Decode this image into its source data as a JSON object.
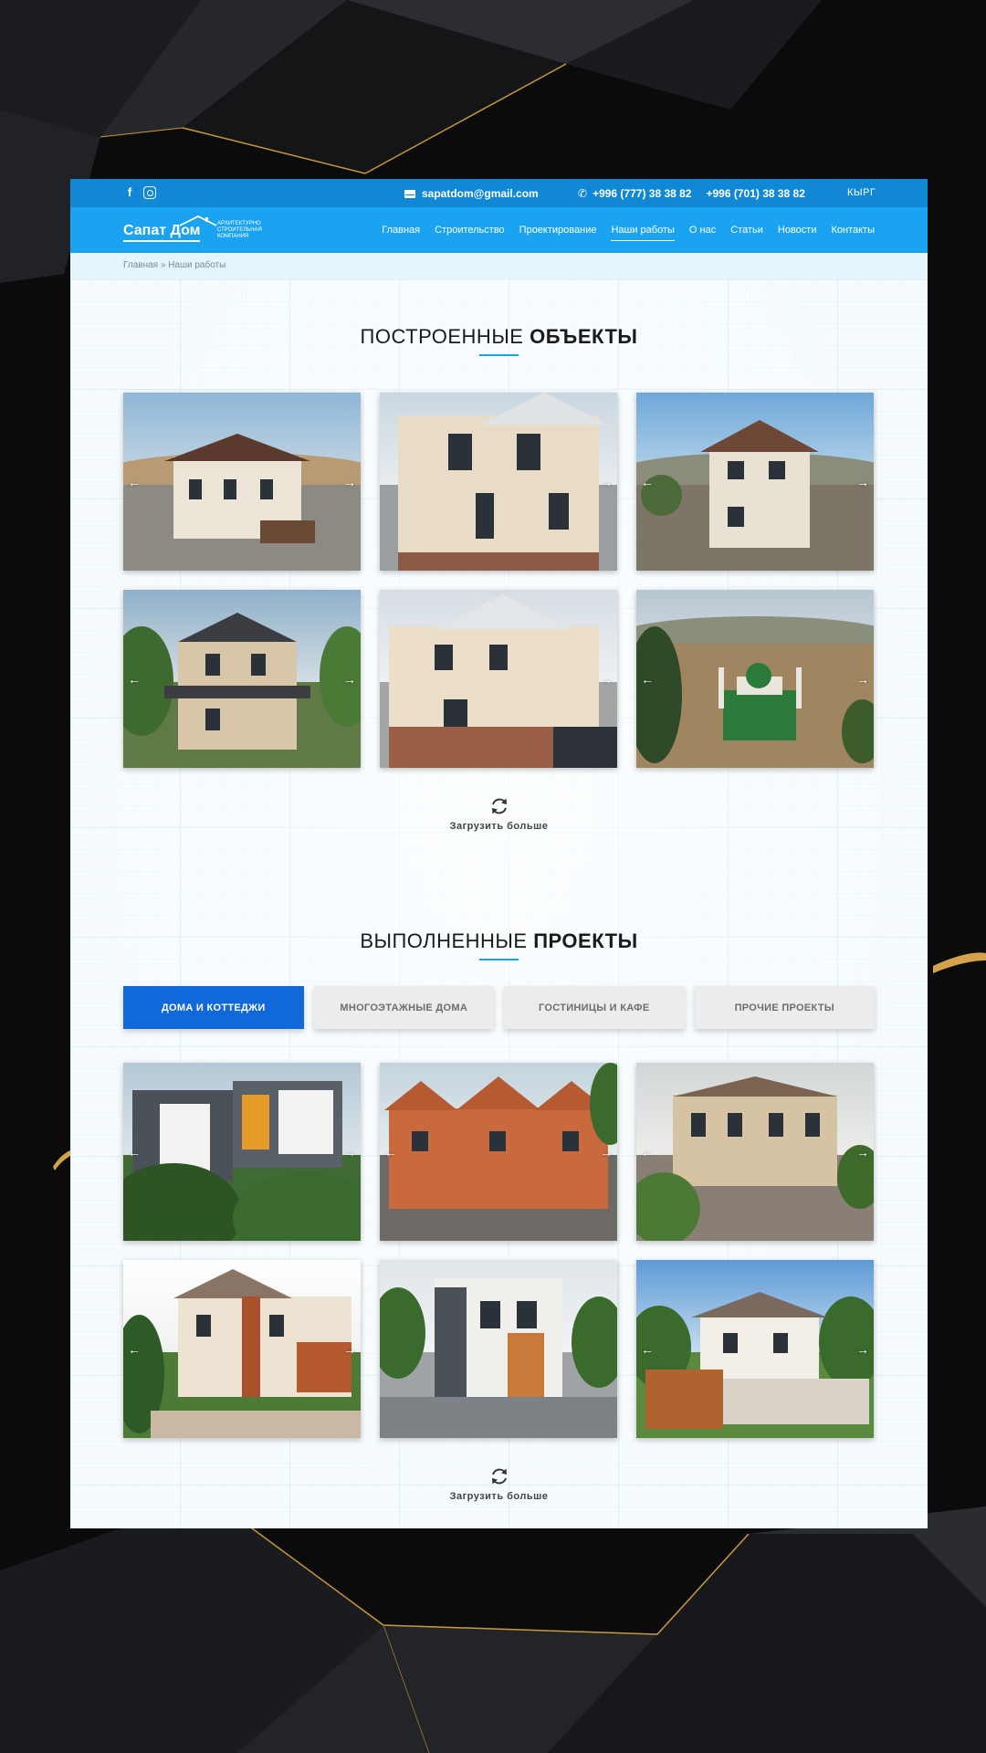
{
  "topbar": {
    "facebook_icon": "facebook-icon",
    "instagram_icon": "instagram-icon",
    "email": "sapatdom@gmail.com",
    "phone_1": "+996 (777) 38 38 82",
    "phone_2": "+996 (701) 38 38 82",
    "language": "КЫРГ"
  },
  "logo": {
    "name": "Сапат Дом",
    "tagline": "Архитектурно строительная компания"
  },
  "nav": {
    "items": [
      "Главная",
      "Строительство",
      "Проектирование",
      "Наши работы",
      "О нас",
      "Статьи",
      "Новости",
      "Контакты"
    ],
    "active": "Наши работы"
  },
  "breadcrumb": "Главная » Наши работы",
  "built": {
    "title_light": "ПОСТРОЕННЫЕ",
    "title_bold": "ОБЪЕКТЫ",
    "load_more": "Загрузить больше"
  },
  "projects": {
    "title_light": "ВЫПОЛНЕННЫЕ",
    "title_bold": "ПРОЕКТЫ",
    "tabs": [
      "ДОМА И КОТТЕДЖИ",
      "МНОГОЭТАЖНЫЕ ДОМА",
      "ГОСТИНИЦЫ И КАФЕ",
      "ПРОЧИЕ ПРОЕКТЫ"
    ],
    "active_tab": "ДОМА И КОТТЕДЖИ",
    "load_more": "Загрузить больше"
  },
  "colors": {
    "topbar": "#1188d6",
    "navbar": "#1aa3f0",
    "active_tab": "#1068db",
    "accent": "#1aa3f0"
  }
}
